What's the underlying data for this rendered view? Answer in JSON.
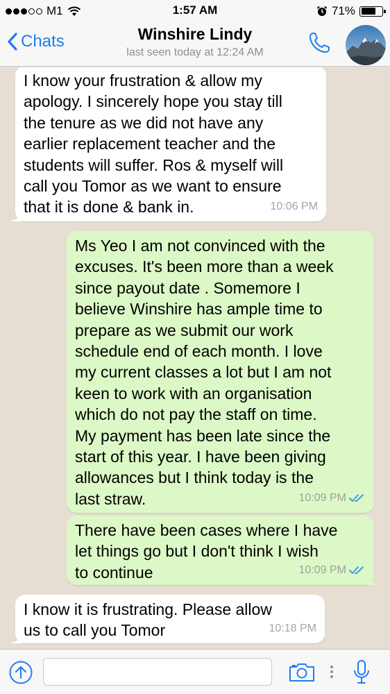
{
  "status_bar": {
    "carrier": "M1",
    "time": "1:57 AM",
    "battery_percent": "71%",
    "battery_level": 0.71,
    "signal_bars_filled": 3,
    "signal_bars_total": 5
  },
  "header": {
    "back_label": "Chats",
    "contact_name": "Winshire Lindy",
    "last_seen": "last seen today at 12:24 AM",
    "phone_icon": "phone-icon",
    "accent_color": "#1f7cf0"
  },
  "messages": [
    {
      "direction": "incoming",
      "text": "I know your frustration & allow my\napology. I sincerely hope you stay till\nthe tenure as we did not have any\nearlier replacement teacher and the\nstudents will suffer. Ros & myself will\ncall you Tomor as we want to ensure\nthat it is done & bank in.",
      "time": "10:06 PM"
    },
    {
      "direction": "outgoing",
      "text": "Ms Yeo I am not convinced with the\nexcuses. It's been more than a week\nsince payout date . Somemore I\nbelieve Winshire has ample time to\nprepare as we submit our work\nschedule end of each month. I love\nmy current classes a lot but I am not\nkeen to work with an organisation\nwhich do not pay the staff on time.\nMy payment has been late since the\nstart of this year. I have been giving\nallowances but I think today is the\nlast straw.",
      "time": "10:09 PM",
      "read": true
    },
    {
      "direction": "outgoing",
      "text": "There have been cases where I have\nlet things go but I don't think I wish\nto continue",
      "time": "10:09 PM",
      "read": true
    },
    {
      "direction": "incoming",
      "text": "I know it is frustrating. Please allow\nus to call you Tomor",
      "time": "10:18 PM"
    }
  ],
  "input_bar": {
    "message_value": "",
    "message_placeholder": ""
  },
  "colors": {
    "outgoing_bubble": "#dcf8c6",
    "incoming_bubble": "#ffffff",
    "read_ticks": "#3b9ee8",
    "chat_background": "#e6ded2"
  }
}
